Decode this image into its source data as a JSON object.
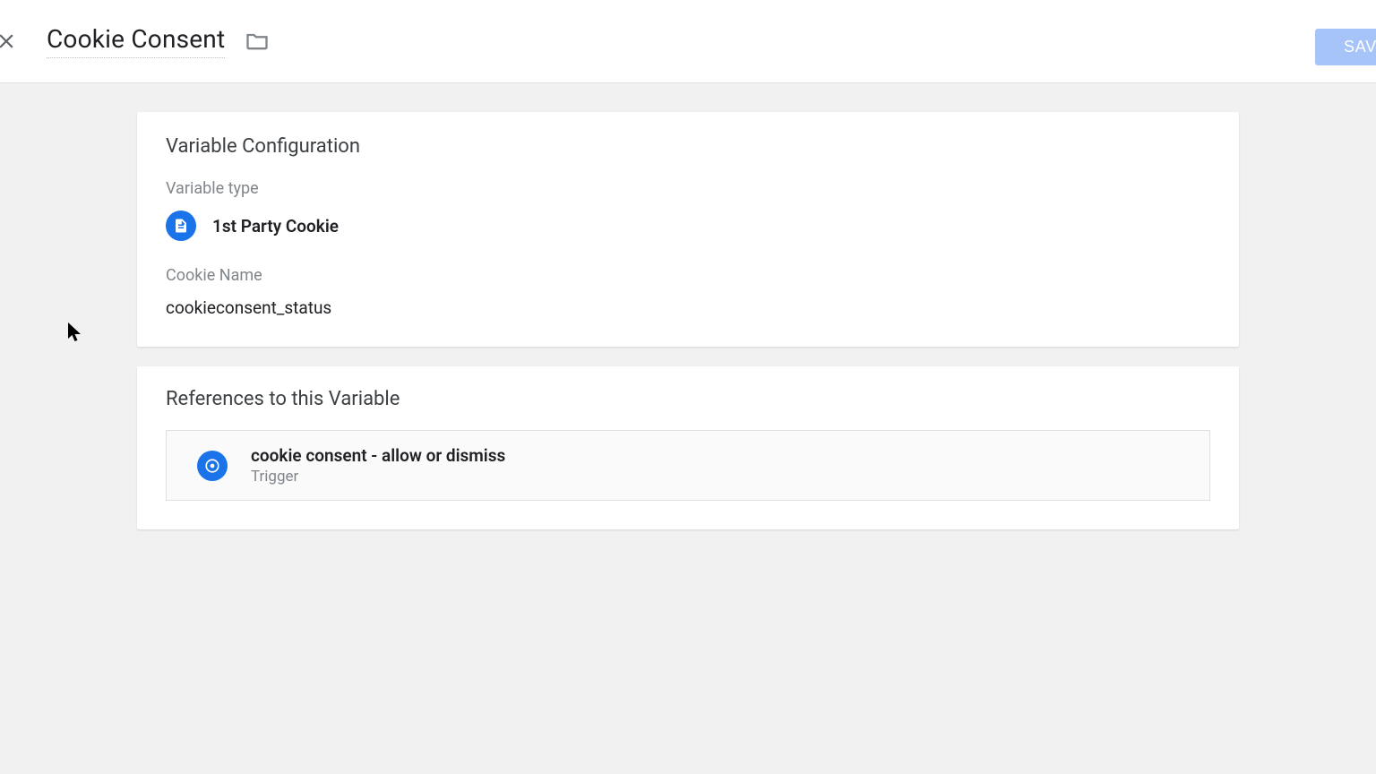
{
  "header": {
    "title": "Cookie Consent",
    "save_label": "SAVE"
  },
  "config": {
    "card_title": "Variable Configuration",
    "type_label": "Variable type",
    "type_name": "1st Party Cookie",
    "cookie_name_label": "Cookie Name",
    "cookie_name_value": "cookieconsent_status"
  },
  "references": {
    "card_title": "References to this Variable",
    "items": [
      {
        "name": "cookie consent - allow or dismiss",
        "type": "Trigger"
      }
    ]
  }
}
